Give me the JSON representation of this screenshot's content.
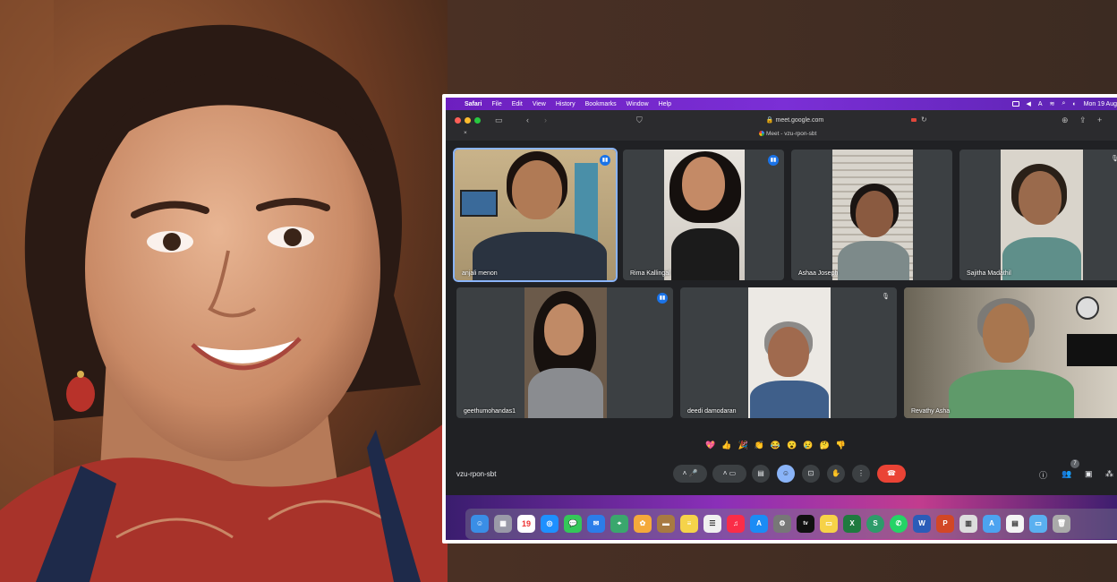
{
  "menubar": {
    "app": "Safari",
    "menus": [
      "File",
      "Edit",
      "View",
      "History",
      "Bookmarks",
      "Window",
      "Help"
    ],
    "clock": "Mon 19 Aug"
  },
  "browser": {
    "url": "meet.google.com",
    "tab_title": "Meet - vzu-rpon-sbt"
  },
  "participants": [
    {
      "name": "anjali menon",
      "speaking": true
    },
    {
      "name": "Rima Kallingal",
      "speaking": true
    },
    {
      "name": "Ashaa Joseph",
      "speaking": false
    },
    {
      "name": "Sajitha Madathil",
      "speaking": false
    },
    {
      "name": "geethumohandas1",
      "speaking": true
    },
    {
      "name": "deedi damodaran",
      "speaking": false
    },
    {
      "name": "Revathy Asha",
      "speaking": false
    }
  ],
  "reactions": [
    "💖",
    "👍",
    "🎉",
    "👏",
    "😂",
    "😮",
    "😢",
    "🤔",
    "👎"
  ],
  "meeting": {
    "code": "vzu-rpon-sbt",
    "people_count": "7"
  },
  "calendar_day": "19",
  "colors": {
    "menubar": "#7b2fd6",
    "meet_bg": "#202124",
    "tile_bg": "#3c4043",
    "accent": "#8ab4f8",
    "end_call": "#ea4335"
  }
}
